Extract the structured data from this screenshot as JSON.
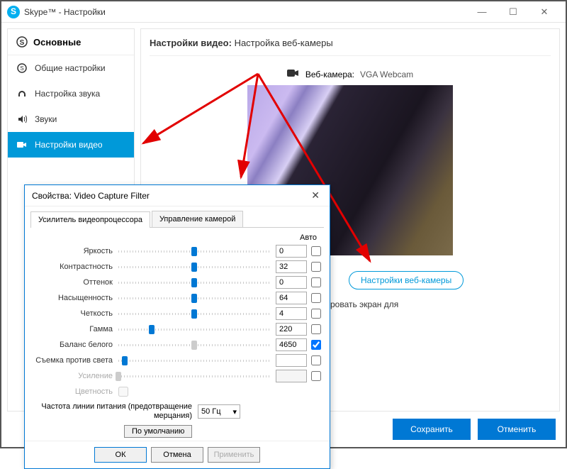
{
  "window": {
    "title": "Skype™ - Настройки"
  },
  "sidebar": {
    "header": "Основные",
    "items": [
      {
        "icon": "skype-icon",
        "label": "Общие настройки"
      },
      {
        "icon": "headset-icon",
        "label": "Настройка звука"
      },
      {
        "icon": "sound-icon",
        "label": "Звуки"
      },
      {
        "icon": "video-icon",
        "label": "Настройки видео"
      }
    ],
    "active_index": 3
  },
  "main": {
    "title_prefix": "Настройки видео:",
    "title_text": "Настройка веб-камеры",
    "webcam_label": "Веб-камера:",
    "webcam_name": "VGA Webcam",
    "webcam_settings_btn": "Настройки веб-камеры",
    "partial_text": "ровать экран для"
  },
  "footer": {
    "save": "Сохранить",
    "cancel": "Отменить"
  },
  "dialog": {
    "title": "Свойства: Video Capture Filter",
    "tabs": [
      "Усилитель видеопроцессора",
      "Управление камерой"
    ],
    "active_tab": 0,
    "auto_header": "Авто",
    "sliders": [
      {
        "label": "Яркость",
        "value": "0",
        "pos": 50,
        "auto": false,
        "enabled": true
      },
      {
        "label": "Контрастность",
        "value": "32",
        "pos": 50,
        "auto": false,
        "enabled": true
      },
      {
        "label": "Оттенок",
        "value": "0",
        "pos": 50,
        "auto": false,
        "enabled": true
      },
      {
        "label": "Насыщенность",
        "value": "64",
        "pos": 50,
        "auto": false,
        "enabled": true
      },
      {
        "label": "Четкость",
        "value": "4",
        "pos": 50,
        "auto": false,
        "enabled": true
      },
      {
        "label": "Гамма",
        "value": "220",
        "pos": 22,
        "auto": false,
        "enabled": true
      },
      {
        "label": "Баланс белого",
        "value": "4650",
        "pos": 50,
        "auto": true,
        "enabled": true,
        "track_disabled": true
      },
      {
        "label": "Съемка против света",
        "value": "",
        "pos": 4,
        "auto": false,
        "enabled": true
      },
      {
        "label": "Усиление",
        "value": "",
        "pos": 0,
        "auto": false,
        "enabled": false
      },
      {
        "label": "Цветность",
        "value": "",
        "pos": 0,
        "auto": false,
        "enabled": false,
        "checkbox_only": true
      }
    ],
    "freq_label": "Частота линии питания (предотвращение мерцания)",
    "freq_value": "50 Гц",
    "default_btn": "По умолчанию",
    "buttons": {
      "ok": "ОК",
      "cancel": "Отмена",
      "apply": "Применить"
    }
  }
}
